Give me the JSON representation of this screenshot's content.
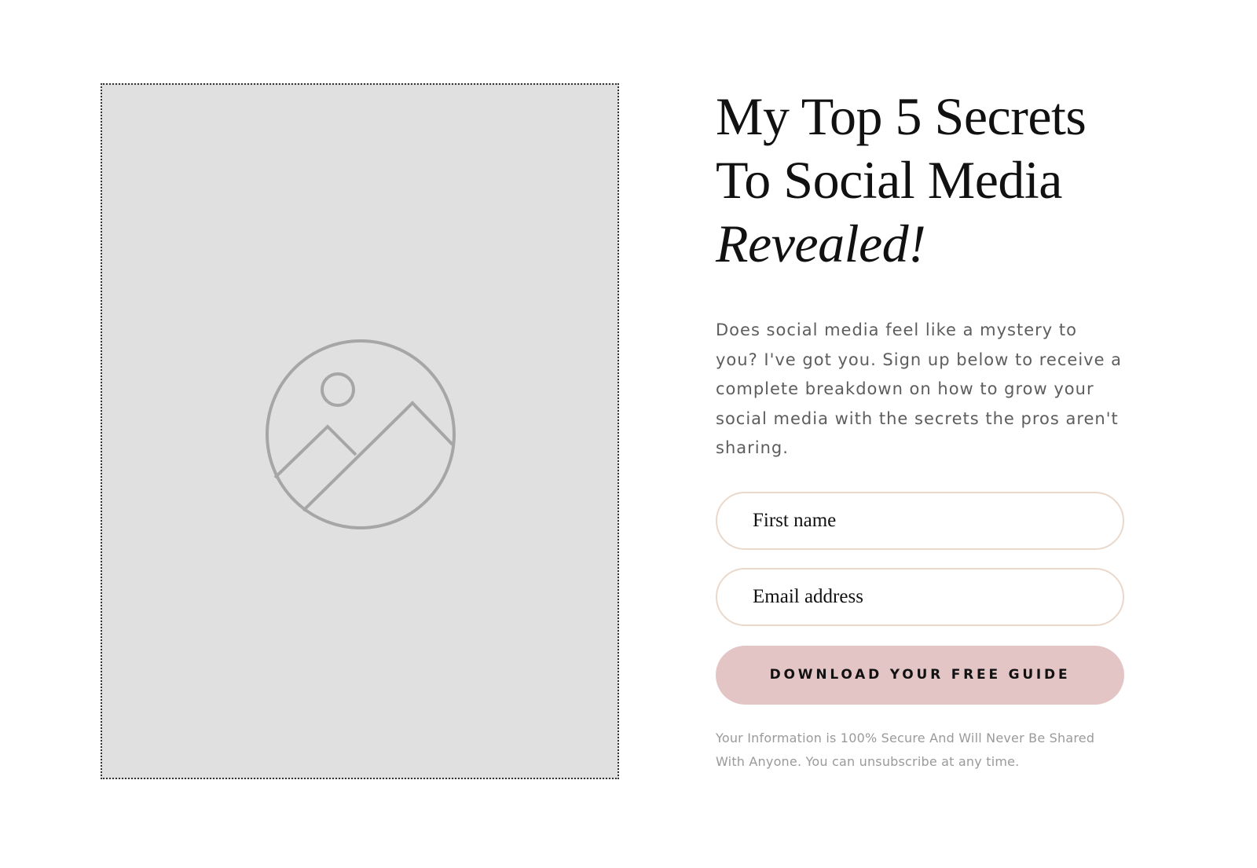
{
  "image": {
    "icon": "image-placeholder-icon",
    "background_color": "#e0e0e0",
    "icon_color": "#a6a6a6"
  },
  "heading": {
    "line1": "My Top 5 Secrets",
    "line2": "To Social Media",
    "line3": "Revealed!"
  },
  "description": "Does social media feel like a mystery to you? I've got you. Sign up below to receive a complete breakdown on how to grow your social media with the secrets the pros aren't sharing.",
  "form": {
    "first_name_placeholder": "First name",
    "email_placeholder": "Email address",
    "submit_label": "DOWNLOAD YOUR FREE GUIDE"
  },
  "disclaimer": "Your Information is 100% Secure And Will Never Be Shared With Anyone. You can unsubscribe at any time.",
  "colors": {
    "field_border": "#ead8cb",
    "button_background": "#e4c5c6",
    "body_text": "#5d5d5d",
    "muted_text": "#9a9a9a"
  }
}
